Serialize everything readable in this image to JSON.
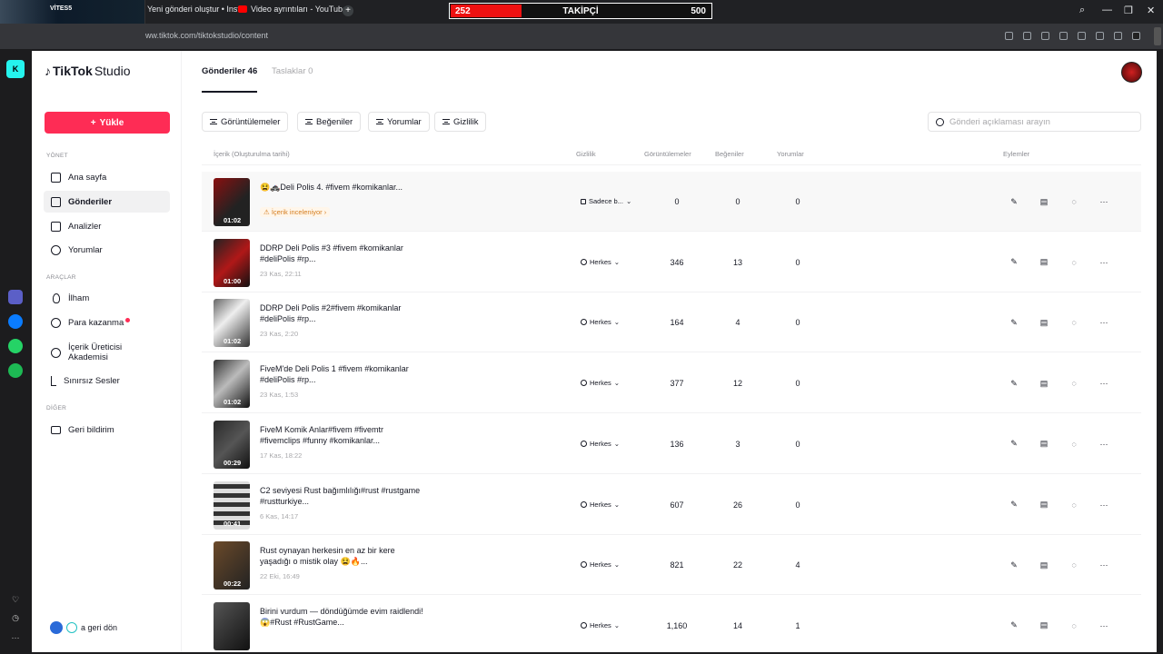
{
  "browser": {
    "media": {
      "title": "VİTES5"
    },
    "tabs": [
      {
        "label": "Yeni gönderi oluştur • Insta"
      },
      {
        "label": "Video ayrıntıları - YouTube"
      }
    ],
    "new_tab": "+",
    "follow_goal": {
      "current": "252",
      "label": "TAKİPÇİ",
      "target": "500",
      "progress": 0.27
    },
    "url": "ww.tiktok.com/tiktokstudio/content",
    "window_controls": {
      "search": "⌕",
      "minimize": "—",
      "restore": "❐",
      "close": "✕"
    }
  },
  "left_strip": {
    "icons": [
      "k-logo-icon",
      "app-icon",
      "messenger-icon",
      "whatsapp-icon",
      "spotify-icon",
      "heart-icon",
      "clock-icon",
      "more-icon"
    ]
  },
  "sidebar": {
    "logo": "TikTok",
    "logo_suffix": "Studio",
    "upload_label": "Yükle",
    "sections": {
      "manage": "YÖNET",
      "tools": "ARAÇLAR",
      "other": "DİĞER"
    },
    "manage_items": [
      {
        "label": "Ana sayfa",
        "icon": "home-icon"
      },
      {
        "label": "Gönderiler",
        "icon": "posts-icon",
        "active": true
      },
      {
        "label": "Analizler",
        "icon": "analytics-icon"
      },
      {
        "label": "Yorumlar",
        "icon": "comments-icon"
      }
    ],
    "tool_items": [
      {
        "label": "İlham",
        "icon": "lightbulb-icon"
      },
      {
        "label": "Para kazanma",
        "icon": "coin-icon"
      },
      {
        "label": "İçerik Üreticisi Akademisi",
        "icon": "academy-icon"
      },
      {
        "label": "Sınırsız Sesler",
        "icon": "music-icon"
      }
    ],
    "other_items": [
      {
        "label": "Geri bildirim",
        "icon": "mail-icon"
      }
    ],
    "back_label": "a geri dön"
  },
  "main": {
    "tabs": [
      {
        "label": "Gönderiler 46",
        "active": true
      },
      {
        "label": "Taslaklar 0",
        "active": false
      }
    ],
    "filters": [
      "Görüntülemeler",
      "Beğeniler",
      "Yorumlar",
      "Gizlilik"
    ],
    "search_placeholder": "Gönderi açıklaması arayın",
    "columns": {
      "content": "İçerik (Oluşturulma tarihi)",
      "privacy": "Gizlilik",
      "views": "Görüntülemeler",
      "likes": "Beğeniler",
      "comments": "Yorumlar",
      "actions": "Eylemler"
    },
    "review_label": "İçerik inceleniyor",
    "posts": [
      {
        "title": "😫🚓Deli Polis 4. #fivem #komikanlar...",
        "date": "",
        "duration": "01:02",
        "privacy": "Sadece b...",
        "views": "0",
        "likes": "0",
        "comments": "0",
        "under_review": true
      },
      {
        "title": "DDRP Deli Polis #3 #fivem #komikanlar #deliPolis #rp...",
        "date": "23 Kas, 22:11",
        "duration": "01:00",
        "privacy": "Herkes",
        "views": "346",
        "likes": "13",
        "comments": "0"
      },
      {
        "title": "DDRP Deli Polis #2#fivem #komikanlar #deliPolis #rp...",
        "date": "23 Kas, 2:20",
        "duration": "01:02",
        "privacy": "Herkes",
        "views": "164",
        "likes": "4",
        "comments": "0"
      },
      {
        "title": "FiveM'de Deli Polis 1 #fivem #komikanlar #deliPolis #rp...",
        "date": "23 Kas, 1:53",
        "duration": "01:02",
        "privacy": "Herkes",
        "views": "377",
        "likes": "12",
        "comments": "0"
      },
      {
        "title": "FiveM Komik Anlar#fivem #fivemtr #fivemclips #funny #komikanlar...",
        "date": "17 Kas, 18:22",
        "duration": "00:29",
        "privacy": "Herkes",
        "views": "136",
        "likes": "3",
        "comments": "0"
      },
      {
        "title": "C2 seviyesi Rust bağımlılığı#rust #rustgame #rustturkiye...",
        "date": "6 Kas, 14:17",
        "duration": "00:41",
        "privacy": "Herkes",
        "views": "607",
        "likes": "26",
        "comments": "0"
      },
      {
        "title": "Rust oynayan herkesin en az bir kere yaşadığı o mistik olay 😫🔥...",
        "date": "22 Eki, 16:49",
        "duration": "00:22",
        "privacy": "Herkes",
        "views": "821",
        "likes": "22",
        "comments": "4"
      },
      {
        "title": "Birini vurdum — döndüğümde evim raidlendi! 😱#Rust #RustGame...",
        "date": "",
        "duration": "",
        "privacy": "Herkes",
        "views": "1,160",
        "likes": "14",
        "comments": "1"
      }
    ],
    "action_glyphs": {
      "edit": "✎",
      "stats": "▤",
      "comment": "◌",
      "more": "···"
    }
  }
}
